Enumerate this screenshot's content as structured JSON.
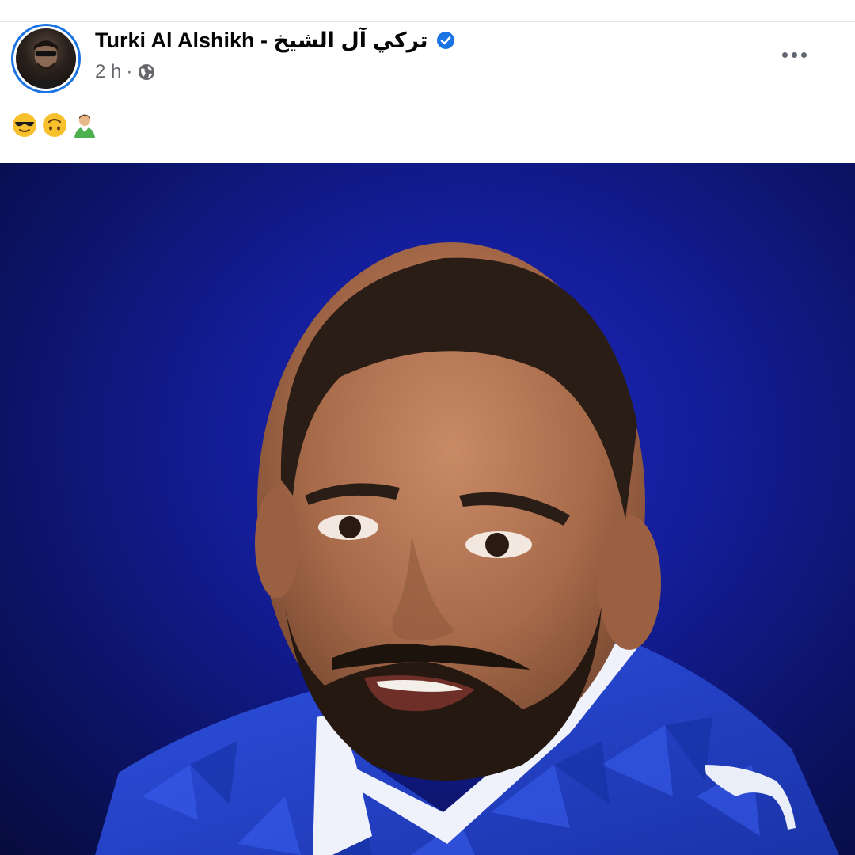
{
  "post": {
    "author_name": "تركي آل الشيخ - Turki Al Alshikh",
    "verified": true,
    "timestamp": "2 h",
    "separator": "·",
    "audience_icon": "globe-icon",
    "more_icon": "more-options-icon",
    "emojis": [
      "smiling-face-with-sunglasses-emoji",
      "upside-down-face-emoji",
      "person-emoji"
    ],
    "image_subject": "player-portrait-photo"
  },
  "colors": {
    "accent": "#1b74e4",
    "text_primary": "#050505",
    "text_secondary": "#65676b",
    "image_background": "#141e9a",
    "jersey_blue": "#2a48d6"
  }
}
